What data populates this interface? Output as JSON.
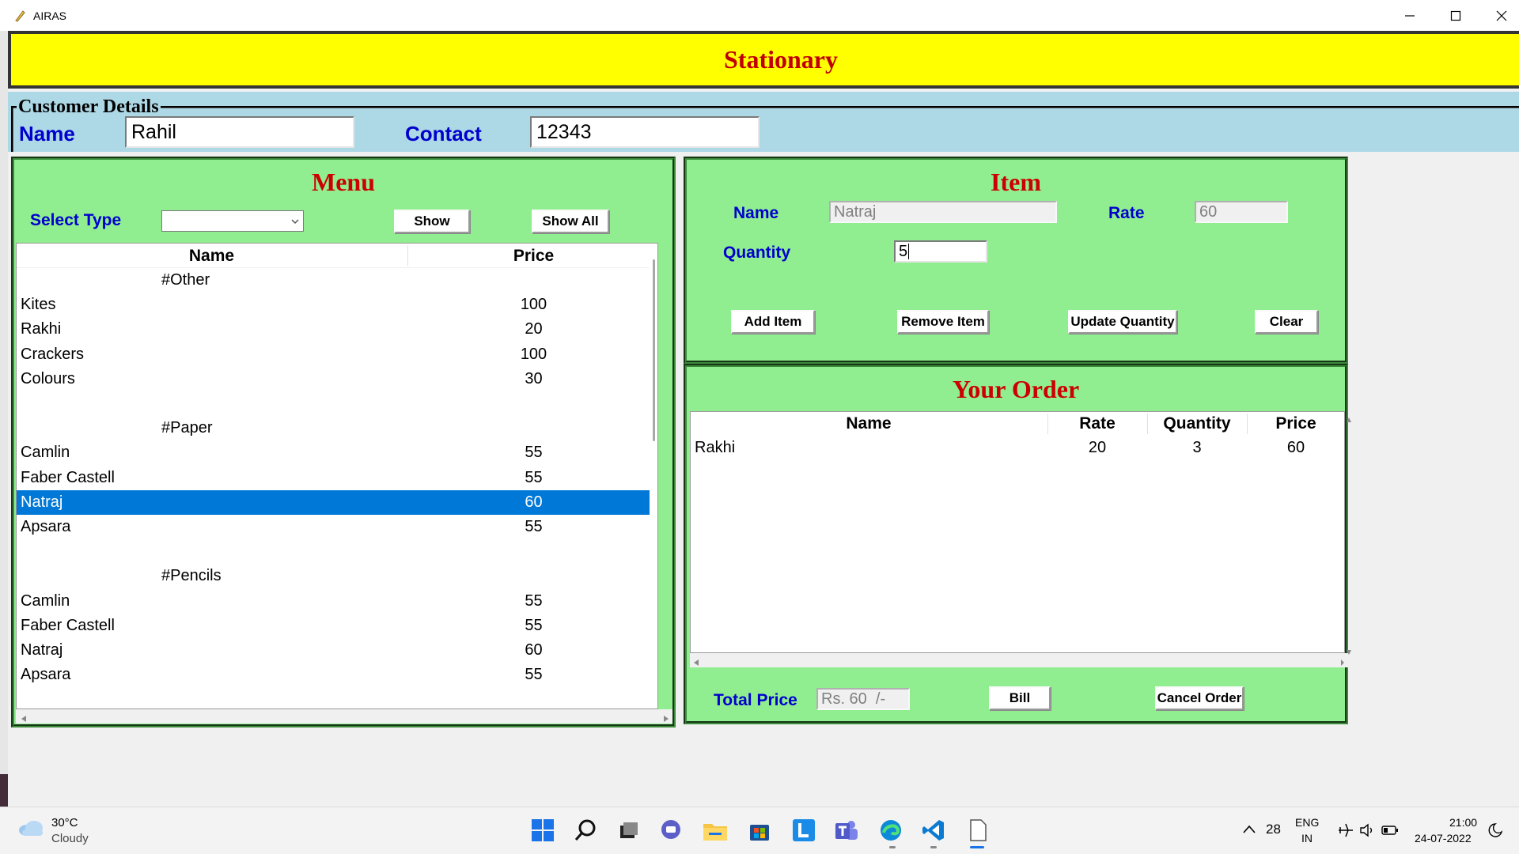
{
  "window": {
    "title": "AIRAS"
  },
  "header": {
    "title": "Stationary"
  },
  "customer": {
    "legend": "Customer Details",
    "name_label": "Name",
    "name_value": "Rahil",
    "contact_label": "Contact",
    "contact_value": "12343"
  },
  "menu": {
    "title": "Menu",
    "select_type_label": "Select Type",
    "select_value": "",
    "show_label": "Show",
    "show_all_label": "Show All",
    "columns": [
      "Name",
      "Price"
    ],
    "rows": [
      {
        "name": "#Other",
        "price": "",
        "heading": true
      },
      {
        "name": "Kites",
        "price": "100"
      },
      {
        "name": "Rakhi",
        "price": "20"
      },
      {
        "name": "Crackers",
        "price": "100"
      },
      {
        "name": "Colours",
        "price": "30"
      },
      {
        "name": "",
        "price": ""
      },
      {
        "name": "#Paper",
        "price": "",
        "heading": true
      },
      {
        "name": "Camlin",
        "price": "55"
      },
      {
        "name": "Faber Castell",
        "price": "55"
      },
      {
        "name": "Natraj",
        "price": "60",
        "selected": true
      },
      {
        "name": "Apsara",
        "price": "55"
      },
      {
        "name": "",
        "price": ""
      },
      {
        "name": "#Pencils",
        "price": "",
        "heading": true
      },
      {
        "name": "Camlin",
        "price": "55"
      },
      {
        "name": "Faber Castell",
        "price": "55"
      },
      {
        "name": "Natraj",
        "price": "60"
      },
      {
        "name": "Apsara",
        "price": "55"
      }
    ]
  },
  "item": {
    "title": "Item",
    "name_label": "Name",
    "name_value": "Natraj",
    "rate_label": "Rate",
    "rate_value": "60",
    "quantity_label": "Quantity",
    "quantity_value": "5",
    "add_label": "Add Item",
    "remove_label": "Remove Item",
    "update_label": "Update Quantity",
    "clear_label": "Clear"
  },
  "order": {
    "title": "Your Order",
    "columns": [
      "Name",
      "Rate",
      "Quantity",
      "Price"
    ],
    "rows": [
      {
        "name": "Rakhi",
        "rate": "20",
        "quantity": "3",
        "price": "60"
      }
    ],
    "total_label": "Total Price",
    "total_value": "Rs. 60  /-",
    "bill_label": "Bill",
    "cancel_label": "Cancel Order"
  },
  "taskbar": {
    "weather_temp": "30°C",
    "weather_desc": "Cloudy",
    "tray_count": "28",
    "lang_line1": "ENG",
    "lang_line2": "IN",
    "time": "21:00",
    "date": "24-07-2022",
    "icons": [
      "start-icon",
      "search-icon",
      "task-view-icon",
      "chat-icon",
      "file-explorer-icon",
      "store-icon",
      "l-app-icon",
      "teams-icon",
      "edge-icon",
      "vscode-icon",
      "notepad-icon"
    ]
  },
  "colors": {
    "header_bg": "#ffff00",
    "title_red": "#cc0000",
    "panel_green": "#90ee90",
    "customer_blue": "#add8e6",
    "label_blue": "#0000cd",
    "selection_blue": "#0078d7"
  }
}
